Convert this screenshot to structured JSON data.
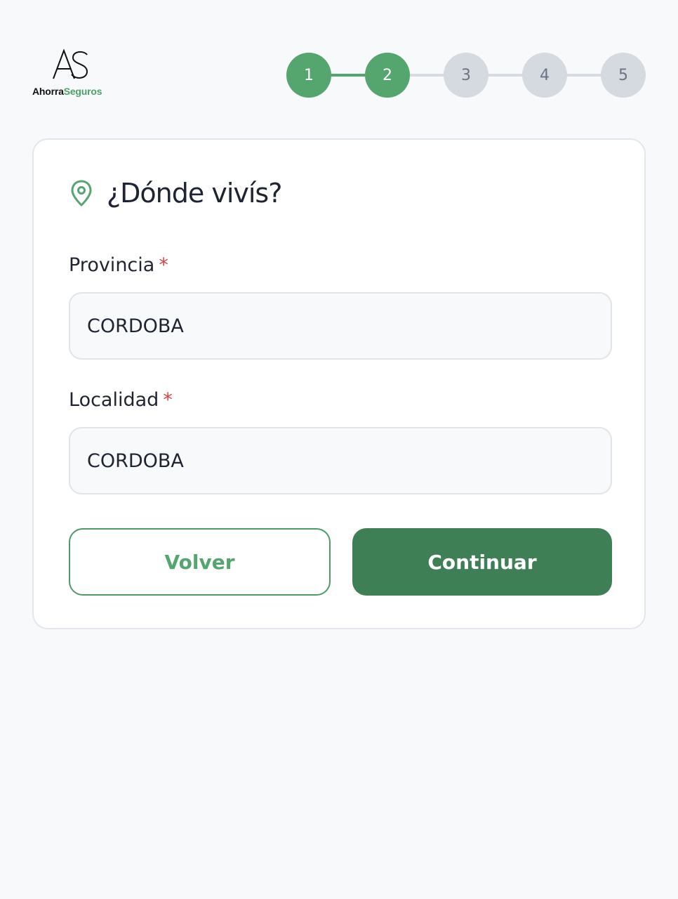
{
  "header": {
    "logo": {
      "mark_text": "AS",
      "name_part1": "Ahorra",
      "name_part2": "Seguros"
    },
    "stepper": {
      "steps": [
        {
          "label": "1",
          "state": "completed"
        },
        {
          "label": "2",
          "state": "current"
        },
        {
          "label": "3",
          "state": "upcoming"
        },
        {
          "label": "4",
          "state": "upcoming"
        },
        {
          "label": "5",
          "state": "upcoming"
        }
      ],
      "current_step": 2,
      "total_steps": 5
    }
  },
  "form": {
    "icon": "location-pin-icon",
    "title": "¿Dónde vivís?",
    "fields": [
      {
        "label": "Provincia",
        "required_marker": "*",
        "value": "CORDOBA"
      },
      {
        "label": "Localidad",
        "required_marker": "*",
        "value": "CORDOBA"
      }
    ],
    "buttons": {
      "back_label": "Volver",
      "continue_label": "Continuar"
    }
  },
  "colors": {
    "brand_green": "#55a56f",
    "primary_button": "#3f7f55",
    "inactive_step": "#d5d9e0",
    "required_marker": "#d64545",
    "background": "#f8f9fb"
  }
}
